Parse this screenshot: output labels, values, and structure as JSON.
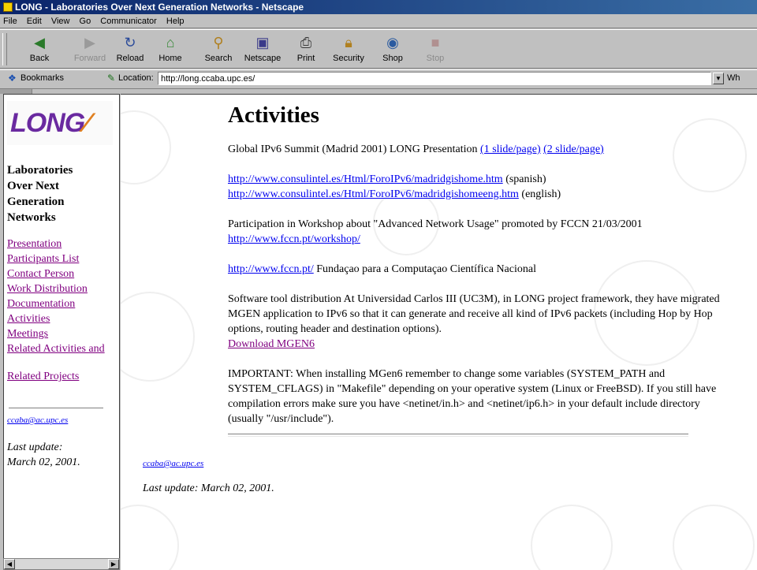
{
  "window": {
    "title": "LONG - Laboratories Over Next Generation Networks - Netscape"
  },
  "menu": [
    "File",
    "Edit",
    "View",
    "Go",
    "Communicator",
    "Help"
  ],
  "toolbar": {
    "buttons": [
      {
        "label": "Back",
        "icon": "back-arrow-icon",
        "enabled": true
      },
      {
        "label": "Forward",
        "icon": "forward-arrow-icon",
        "enabled": false
      },
      {
        "label": "Reload",
        "icon": "reload-icon",
        "enabled": true
      },
      {
        "label": "Home",
        "icon": "home-icon",
        "enabled": true
      },
      {
        "label": "Search",
        "icon": "search-icon",
        "enabled": true
      },
      {
        "label": "Netscape",
        "icon": "netscape-icon",
        "enabled": true
      },
      {
        "label": "Print",
        "icon": "print-icon",
        "enabled": true
      },
      {
        "label": "Security",
        "icon": "lock-icon",
        "enabled": true
      },
      {
        "label": "Shop",
        "icon": "shop-icon",
        "enabled": true
      },
      {
        "label": "Stop",
        "icon": "stop-icon",
        "enabled": false
      }
    ]
  },
  "location": {
    "bookmarks_label": "Bookmarks",
    "label": "Location:",
    "url": "http://long.ccaba.upc.es/",
    "whats_related": "Wh"
  },
  "sidebar": {
    "logo_text": "LONG",
    "title_lines": [
      "Laboratories",
      "Over Next",
      "Generation",
      "Networks"
    ],
    "links": [
      "Presentation",
      "Participants List",
      "Contact Person",
      "Work Distribution",
      "Documentation",
      "Activities",
      "Meetings",
      "Related Activities and"
    ],
    "related_projects": "Related Projects",
    "email": "ccaba@ac.upc.es",
    "last_update_label": "Last update:",
    "last_update_date": "March 02, 2001."
  },
  "main": {
    "title": "Activities",
    "summit_text": "Global IPv6 Summit (Madrid 2001) LONG Presentation",
    "summit_link1": "(1 slide/page)",
    "summit_link2": "(2 slide/page)",
    "url_spanish": "http://www.consulintel.es/Html/ForoIPv6/madridgishome.htm",
    "spanish_label": "(spanish)",
    "url_english": "http://www.consulintel.es/Html/ForoIPv6/madridgishomeeng.htm",
    "english_label": "(english)",
    "workshop_text": "Participation in Workshop about \"Advanced Network Usage\" promoted by FCCN 21/03/2001",
    "workshop_url": "http://www.fccn.pt/workshop/",
    "fccn_url": "http://www.fccn.pt/",
    "fccn_text": "Fundaçao para a Computaçao Científica Nacional",
    "software_text": "Software tool distribution At Universidad Carlos III (UC3M), in LONG project framework, they have migrated MGEN application to IPv6 so that it can generate and receive all kind of IPv6 packets (including Hop by Hop options, routing header and destination options).",
    "download_link": "Download MGEN6",
    "important_text": "IMPORTANT: When installing MGen6 remember to change some variables (SYSTEM_PATH and SYSTEM_CFLAGS) in \"Makefile\" depending on your operative system (Linux or FreeBSD). If you still have compilation errors make sure you have <netinet/in.h> and <netinet/ip6.h> in your default include directory (usually \"/usr/include\").",
    "email": "ccaba@ac.upc.es",
    "last_update": "Last update: March 02, 2001."
  }
}
